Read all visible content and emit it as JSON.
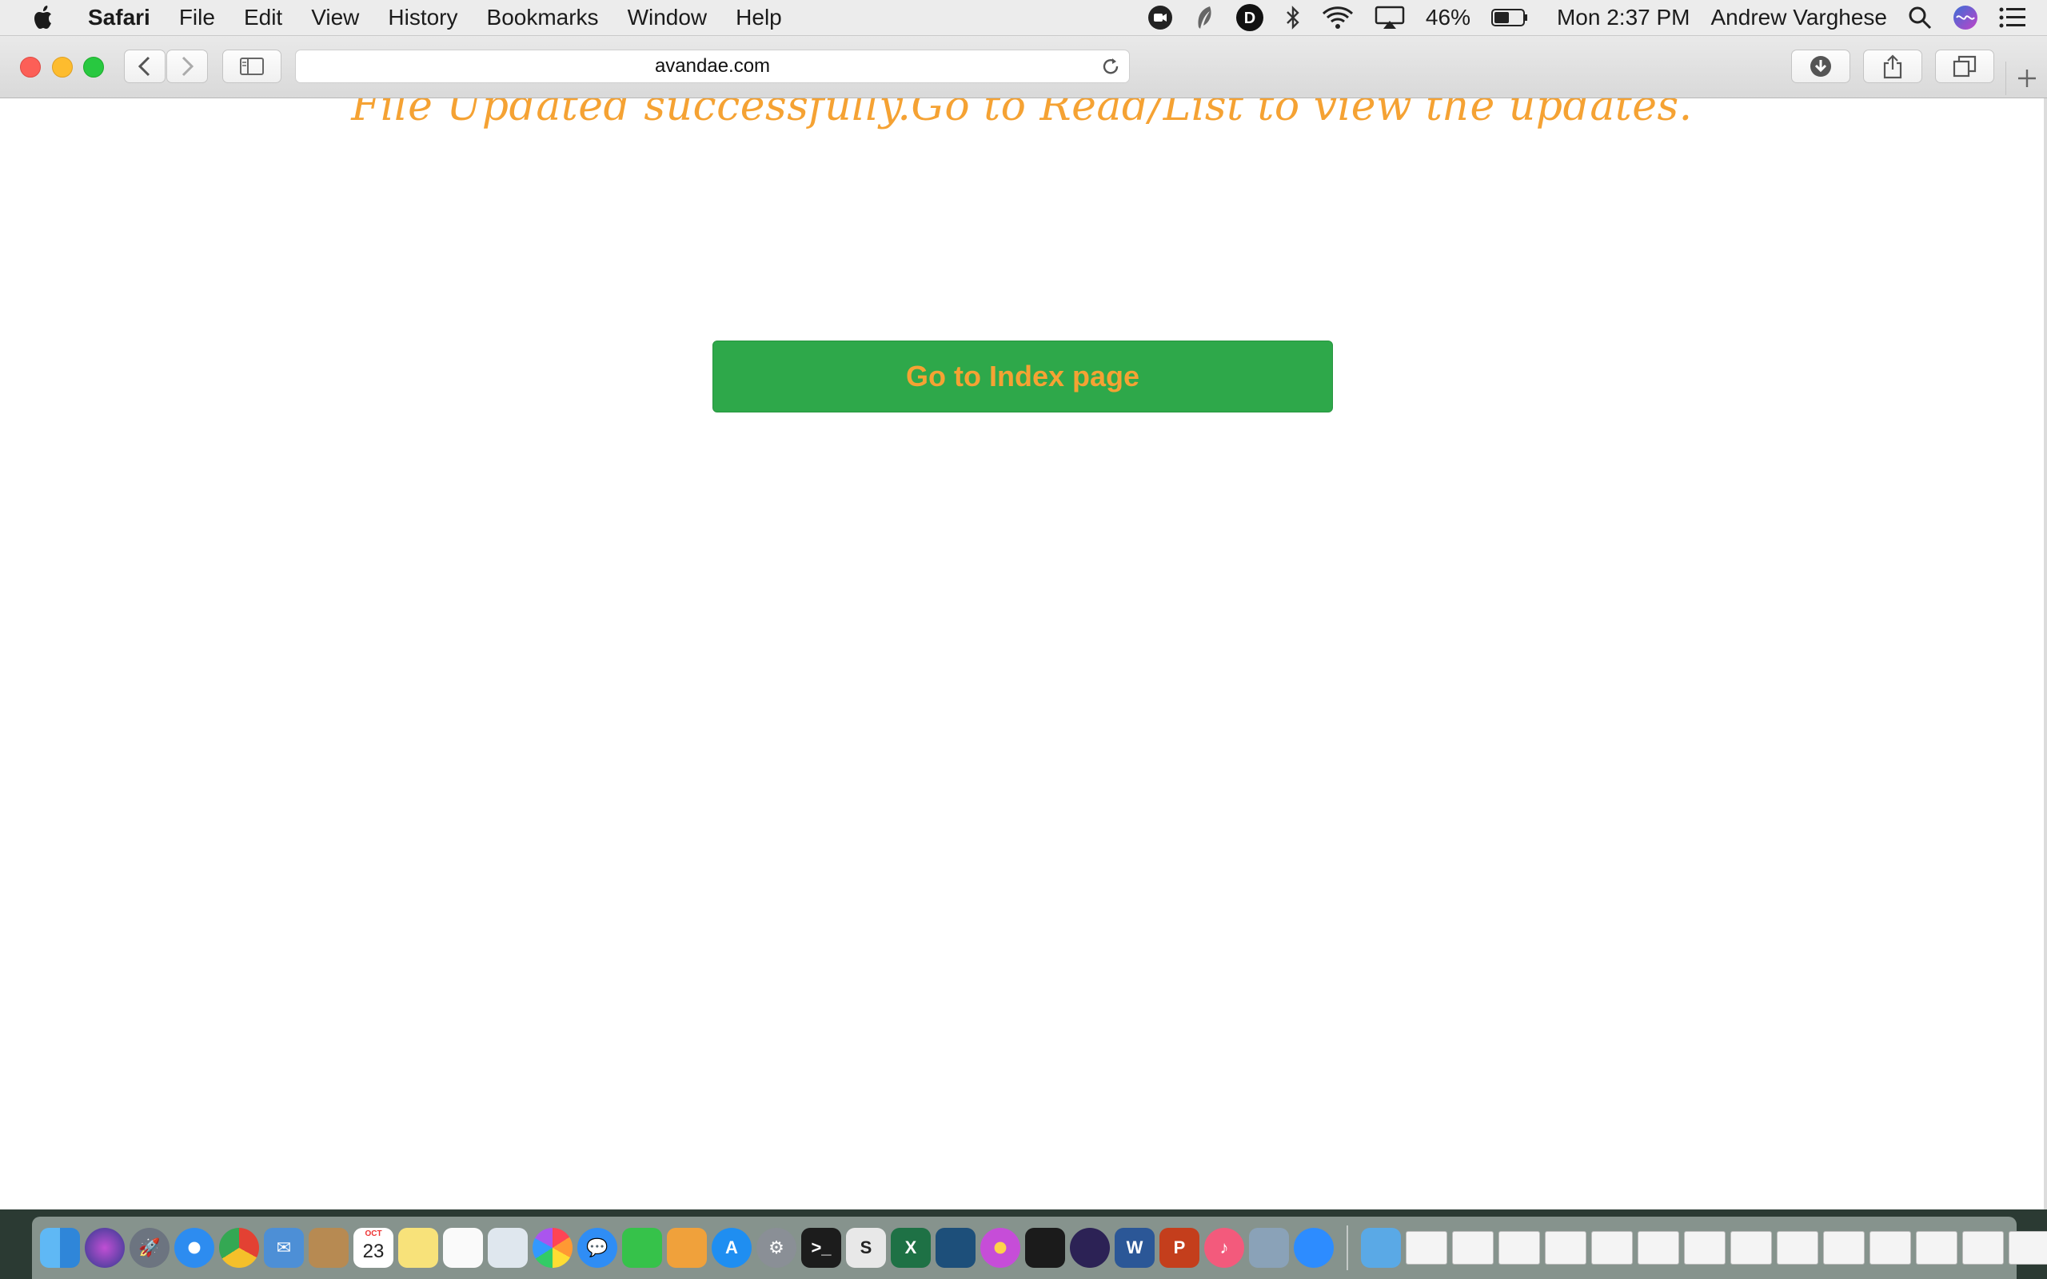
{
  "menubar": {
    "app_name": "Safari",
    "items": [
      "File",
      "Edit",
      "View",
      "History",
      "Bookmarks",
      "Window",
      "Help"
    ],
    "battery_percent": "46%",
    "clock": "Mon 2:37 PM",
    "user": "Andrew Varghese"
  },
  "browser": {
    "url": "avandae.com"
  },
  "page": {
    "message": "File Updated successfully.Go to Read/List to view the updates.",
    "button_label": "Go to Index page",
    "message_color": "#f5a233",
    "button_color": "#2ea84a"
  },
  "dock": {
    "calendar_month": "OCT",
    "calendar_day": "23"
  }
}
